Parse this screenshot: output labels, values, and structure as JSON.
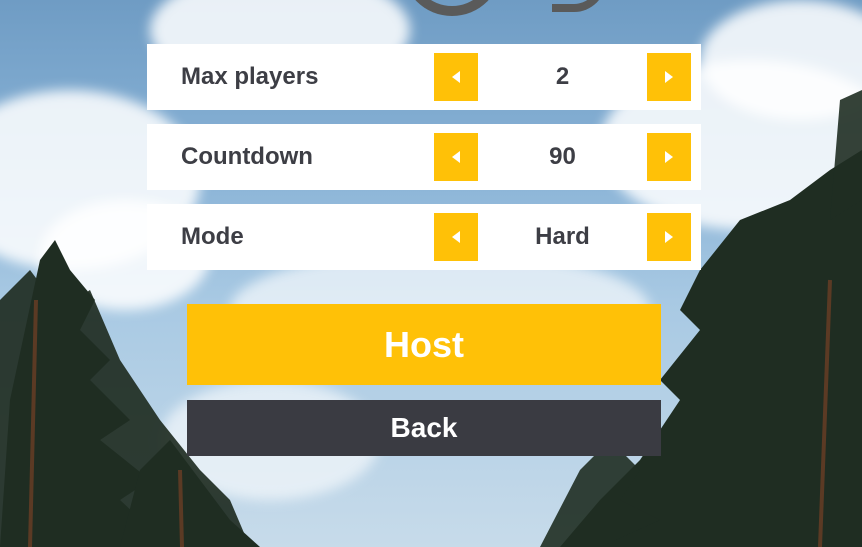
{
  "settings": [
    {
      "label": "Max players",
      "value": "2"
    },
    {
      "label": "Countdown",
      "value": "90"
    },
    {
      "label": "Mode",
      "value": "Hard"
    }
  ],
  "actions": {
    "host_label": "Host",
    "back_label": "Back"
  },
  "icons": {
    "decrease": "chevron-left-icon",
    "increase": "chevron-right-icon"
  },
  "colors": {
    "accent": "#ffc107",
    "panel": "#ffffff",
    "text": "#3d3e45",
    "back_button": "#3a3b42"
  }
}
